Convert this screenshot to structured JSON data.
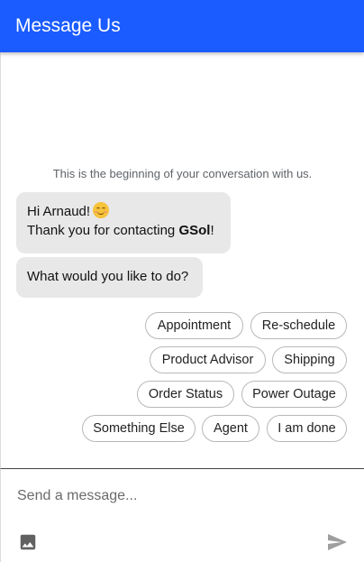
{
  "header": {
    "title": "Message Us"
  },
  "conversation": {
    "beginning_notice": "This is the beginning of your conversation with us.",
    "messages": [
      {
        "greeting": "Hi Arnaud!",
        "emoji": "smiling-face-emoji",
        "line2_prefix": "Thank you for contacting ",
        "line2_bold": "GSol",
        "line2_suffix": "!"
      },
      {
        "text": "What would you like to do?"
      }
    ],
    "quick_replies": [
      "Appointment",
      "Re-schedule",
      "Product Advisor",
      "Shipping",
      "Order Status",
      "Power Outage",
      "Something Else",
      "Agent",
      "I am done"
    ]
  },
  "composer": {
    "placeholder": "Send a message...",
    "image_icon": "image-icon",
    "send_icon": "send-icon"
  },
  "colors": {
    "header_bg": "#1a5cff",
    "bubble_bg": "#e8e8e8",
    "chip_border": "#b8b8b8",
    "send_icon": "#9e9e9e"
  }
}
